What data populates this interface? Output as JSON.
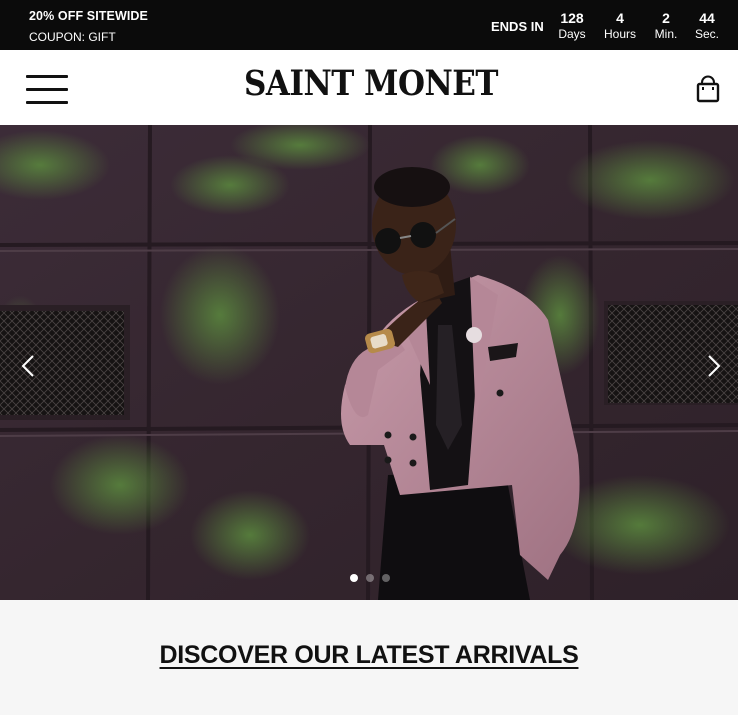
{
  "promo": {
    "headline": "20% OFF SITEWIDE",
    "coupon": "COUPON: GIFT",
    "ends_label": "ENDS IN",
    "countdown": [
      {
        "value": "128",
        "unit": "Days"
      },
      {
        "value": "4",
        "unit": "Hours"
      },
      {
        "value": "2",
        "unit": "Min."
      },
      {
        "value": "44",
        "unit": "Sec."
      }
    ]
  },
  "header": {
    "logo": "SAINT MONET",
    "menu_icon": "hamburger-menu-icon",
    "cart_icon": "shopping-bag-icon"
  },
  "hero": {
    "slides_count": 3,
    "active_slide": 1,
    "prev_icon": "chevron-left-icon",
    "next_icon": "chevron-right-icon"
  },
  "section": {
    "title": "DISCOVER OUR LATEST ARRIVALS"
  },
  "colors": {
    "promo_bg": "#0b0b0b",
    "header_bg": "#ffffff",
    "page_bg": "#f6f6f6",
    "text": "#111111"
  }
}
